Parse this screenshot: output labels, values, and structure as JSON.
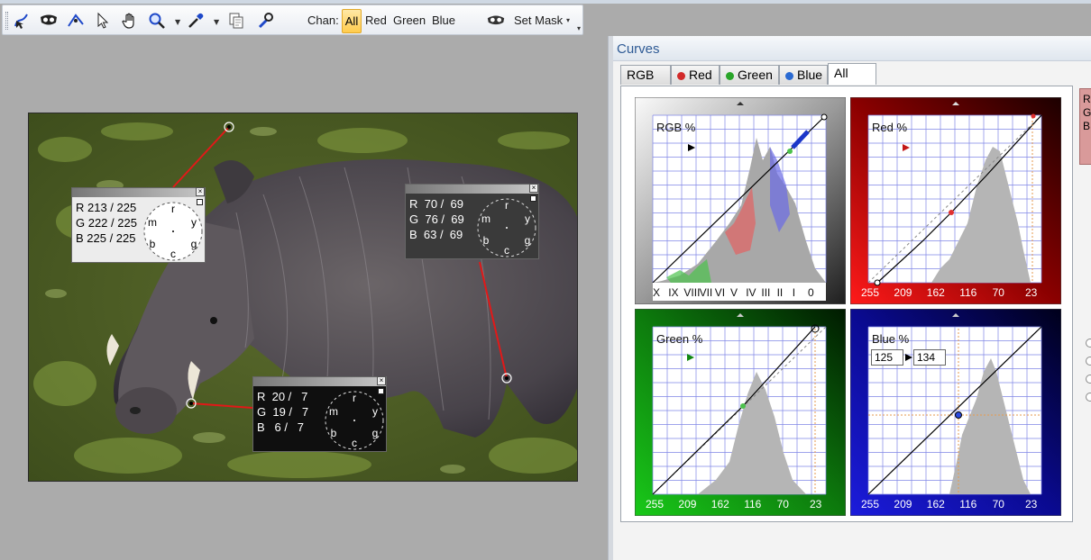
{
  "toolbar": {
    "icons": [
      "curve-pointer-icon",
      "mask-icon",
      "pen-icon",
      "arrow-cursor-icon",
      "hand-icon",
      "magnifier-icon",
      "eyedropper-icon",
      "copy-icon",
      "wrench-icon"
    ],
    "chan_label": "Chan:",
    "channels": [
      "All",
      "Red",
      "Green",
      "Blue"
    ],
    "active_channel": "All",
    "set_mask_label": "Set Mask"
  },
  "probes": [
    {
      "lines": [
        "R 213 / 225",
        "G 222 / 225",
        "B 225 / 225"
      ],
      "wheel_letters": [
        "r",
        "y",
        "g",
        "c",
        "b",
        "m"
      ]
    },
    {
      "lines": [
        "R  70 /  69",
        "G  76 /  69",
        "B  63 /  69"
      ],
      "wheel_letters": [
        "r",
        "y",
        "g",
        "c",
        "b",
        "m"
      ]
    },
    {
      "lines": [
        "R  20 /   7",
        "G  19 /   7",
        "B   6 /   7"
      ],
      "wheel_letters": [
        "r",
        "y",
        "g",
        "c",
        "b",
        "m"
      ]
    }
  ],
  "panel": {
    "title": "Curves",
    "tabs": [
      {
        "label": "RGB",
        "dot": ""
      },
      {
        "label": "Red",
        "dot": "#d22a2a"
      },
      {
        "label": "Green",
        "dot": "#2aa52a"
      },
      {
        "label": "Blue",
        "dot": "#2a6ad2"
      },
      {
        "label": "All",
        "dot": ""
      }
    ],
    "active_tab": "All"
  },
  "curves": {
    "rgb": {
      "label": "RGB %",
      "xlabels": [
        "X",
        "IX",
        "VIII",
        "VII",
        "VI",
        "V",
        "IV",
        "III",
        "II",
        "I",
        "0"
      ]
    },
    "red": {
      "label": "Red %",
      "xlabels": [
        "255",
        "209",
        "162",
        "116",
        "70",
        "23"
      ]
    },
    "green": {
      "label": "Green %",
      "xlabels": [
        "255",
        "209",
        "162",
        "116",
        "70",
        "23"
      ]
    },
    "blue": {
      "label": "Blue %",
      "xlabels": [
        "255",
        "209",
        "162",
        "116",
        "70",
        "23"
      ],
      "input_value": "125",
      "output_value": "134"
    }
  },
  "side_stub_letters": [
    "R",
    "G",
    "B"
  ],
  "colors": {
    "red_frame": "#c40000",
    "green_frame": "#119311",
    "blue_frame": "#1010b8",
    "grid": "#7f86e6",
    "probe_line": "#e21818",
    "toolbar_active": "#ffcc4d",
    "panel_title_text": "#2f5b95"
  }
}
